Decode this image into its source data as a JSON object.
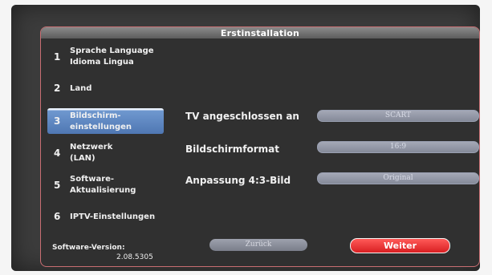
{
  "header": {
    "title": "Erstinstallation"
  },
  "menu": {
    "items": [
      {
        "number": "1",
        "line1": "Sprache Language",
        "line2": "Idioma Lingua"
      },
      {
        "number": "2",
        "line1": "Land",
        "line2": ""
      },
      {
        "number": "3",
        "line1": "Bildschirm-",
        "line2": "einstellungen"
      },
      {
        "number": "4",
        "line1": "Netzwerk",
        "line2": "(LAN)"
      },
      {
        "number": "5",
        "line1": "Software-",
        "line2": "Aktualisierung"
      },
      {
        "number": "6",
        "line1": "IPTV-Einstellungen",
        "line2": ""
      }
    ],
    "active_index": 2
  },
  "settings": [
    {
      "label": "TV angeschlossen an",
      "value": "SCART"
    },
    {
      "label": "Bildschirmformat",
      "value": "16:9"
    },
    {
      "label": "Anpassung 4:3-Bild",
      "value": "Original"
    }
  ],
  "footer": {
    "version_label": "Software-Version:",
    "version_value": "2.08.5305",
    "back_label": "Zurück",
    "next_label": "Weiter"
  },
  "colors": {
    "panel_border": "#c86e72",
    "active_item": "#4f77b3",
    "next_button": "#d81f22"
  }
}
